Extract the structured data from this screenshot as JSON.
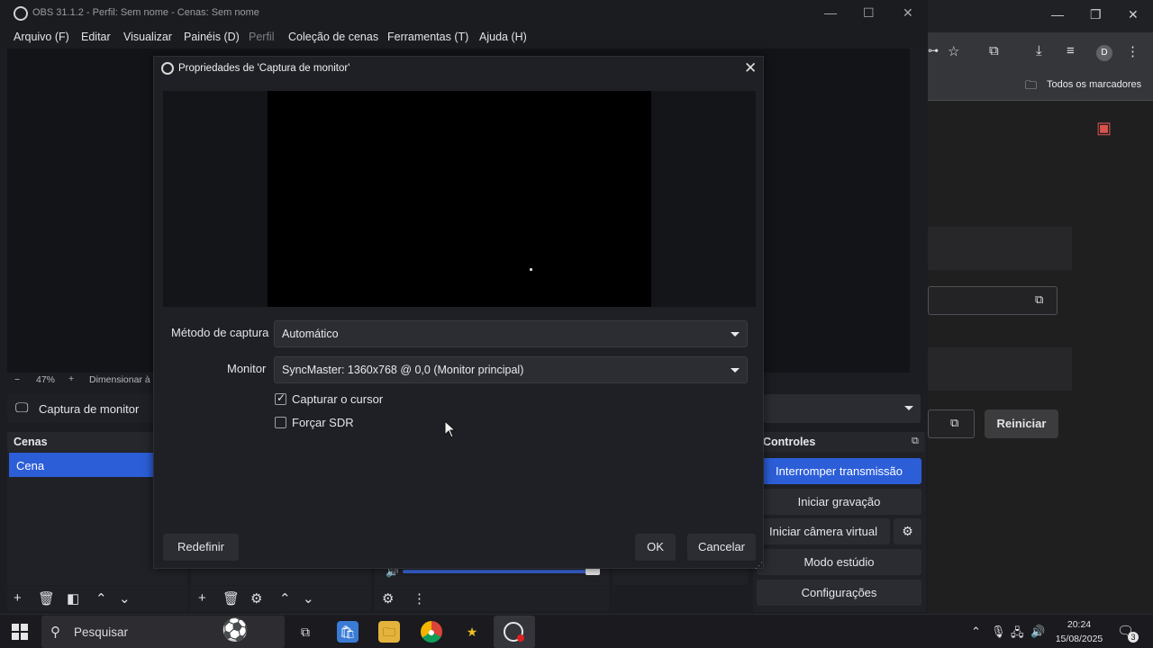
{
  "obs_window": {
    "title": "OBS 31.1.2 - Perfil: Sem nome - Cenas: Sem nome",
    "menu": [
      "Arquivo (F)",
      "Editar",
      "Visualizar",
      "Painéis (D)",
      "Perfil",
      "Coleção de cenas",
      "Ferramentas (T)",
      "Ajuda (H)"
    ],
    "zoom": "47%",
    "zoom_minus": "−",
    "zoom_plus": "+",
    "scale_label": "Dimensionar à",
    "source_title": "Captura de monitor",
    "scenes_header": "Cenas",
    "scene_item": "Cena",
    "controls_header": "Controles",
    "controls": {
      "stop_stream": "Interromper transmissão",
      "start_recording": "Iniciar gravação",
      "start_virtual_cam": "Iniciar câmera virtual",
      "studio_mode": "Modo estúdio",
      "settings": "Configurações"
    }
  },
  "dialog": {
    "title": "Propriedades de 'Captura de monitor'",
    "capture_method_label": "Método de captura",
    "capture_method_value": "Automático",
    "monitor_label": "Monitor",
    "monitor_value": "SyncMaster: 1360x768 @ 0,0 (Monitor principal)",
    "capture_cursor_label": "Capturar o cursor",
    "capture_cursor_checked": true,
    "force_sdr_label": "Forçar SDR",
    "force_sdr_checked": false,
    "reset_label": "Redefinir",
    "ok_label": "OK",
    "cancel_label": "Cancelar"
  },
  "browser": {
    "bookmarks_label": "Todos os marcadores",
    "avatar_letter": "D",
    "restart_label": "Reiniciar"
  },
  "taskbar": {
    "search_label": "Pesquisar",
    "time": "20:24",
    "date": "15/08/2025",
    "notification_count": "3"
  }
}
